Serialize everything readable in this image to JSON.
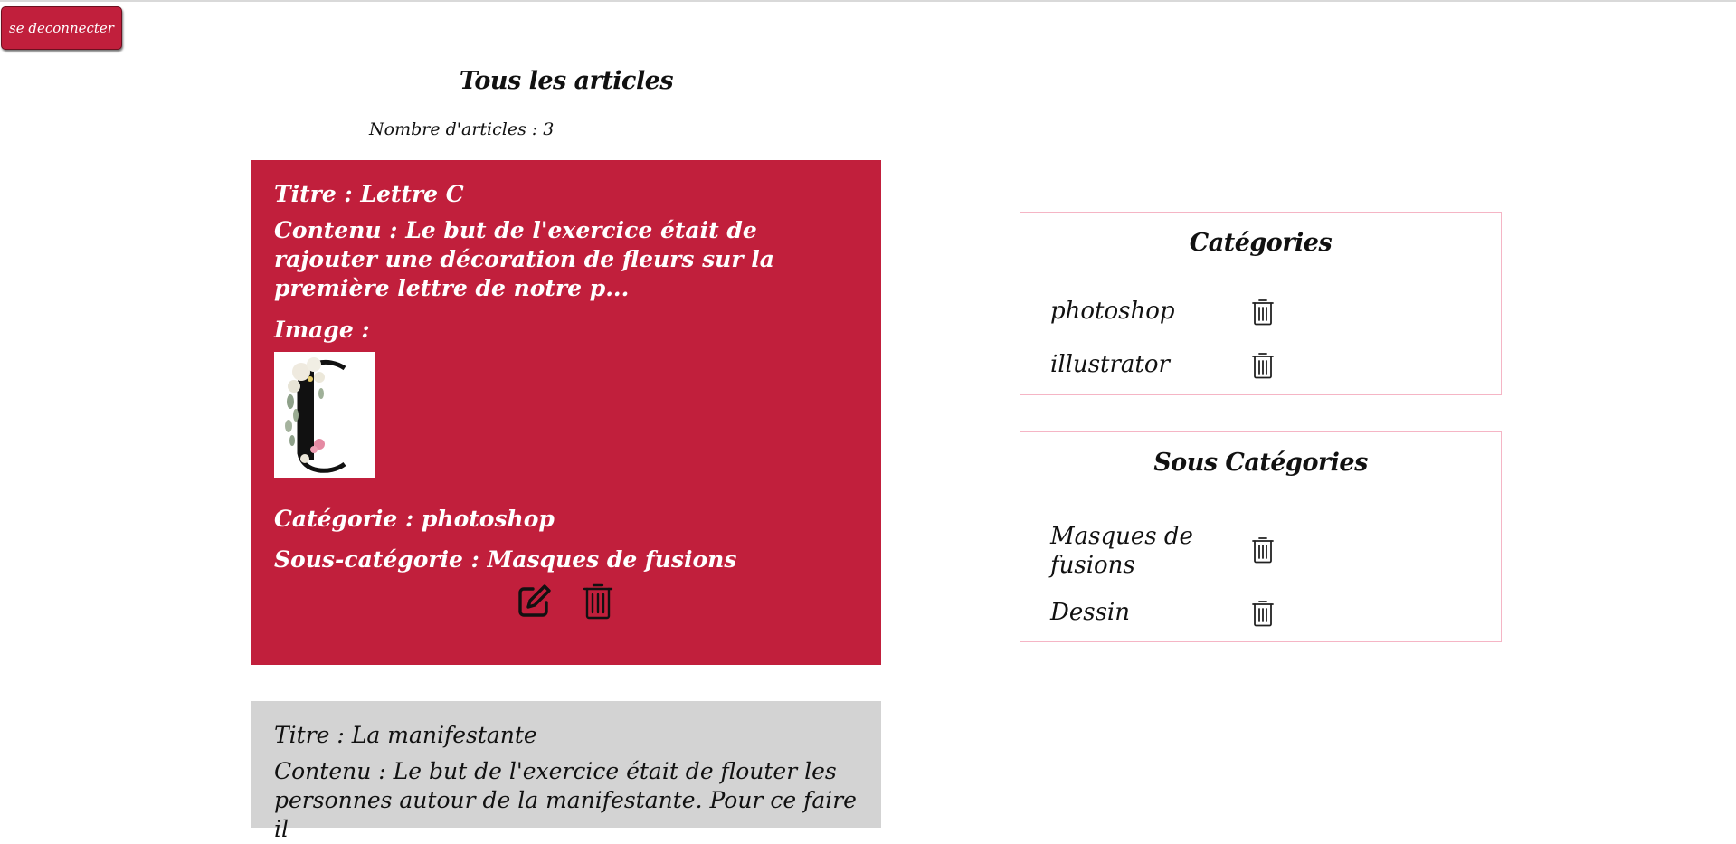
{
  "header": {
    "logout_label": "se deconnecter"
  },
  "articles_section": {
    "title": "Tous les articles",
    "count_text": "Nombre d'articles : 3"
  },
  "articles": [
    {
      "title_line": "Titre : Lettre C",
      "content_line": "Contenu : Le but de l'exercice était de rajouter une décoration de fleurs sur la première lettre de notre p...",
      "image_label": "Image :",
      "category_line": "Catégorie : photoshop",
      "subcategory_line": "Sous-catégorie : Masques de fusions"
    },
    {
      "title_line": "Titre : La manifestante",
      "content_line": "Contenu : Le but de l'exercice était de flouter les personnes autour de la manifestante. Pour ce faire il"
    }
  ],
  "categories_panel": {
    "title": "Catégories",
    "items": [
      {
        "label": "photoshop",
        "delete_icon": "trash-icon"
      },
      {
        "label": "illustrator",
        "delete_icon": "trash-icon"
      }
    ]
  },
  "subcategories_panel": {
    "title": "Sous Catégories",
    "items": [
      {
        "label": "Masques de fusions",
        "delete_icon": "trash-icon"
      },
      {
        "label": "Dessin",
        "delete_icon": "trash-icon"
      }
    ]
  },
  "colors": {
    "accent": "#c11f3c",
    "card_alt": "#d3d3d3",
    "panel_border": "#f5b5c5"
  },
  "icons": {
    "edit": "edit-icon",
    "delete": "trash-icon"
  }
}
